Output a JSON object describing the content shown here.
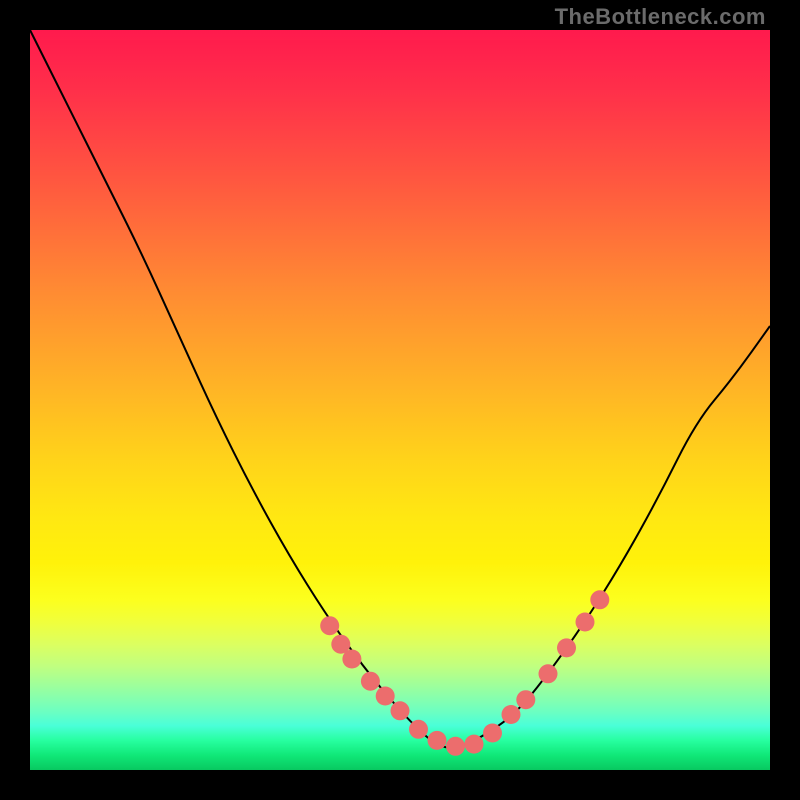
{
  "watermark": "TheBottleneck.com",
  "colors": {
    "frame": "#000000",
    "dot": "#ec6d6d",
    "curve": "#000000",
    "gradient_top": "#ff1a4d",
    "gradient_bottom": "#08c860"
  },
  "chart_data": {
    "type": "line",
    "title": "",
    "xlabel": "",
    "ylabel": "",
    "xlim": [
      0,
      100
    ],
    "ylim": [
      0,
      100
    ],
    "note": "Axes are unlabeled; x/y are percent of plot span. y is the bottleneck metric (high=red/bad, low=green/good). Curve descends steeply, bottoms near x≈56, then rises.",
    "series": [
      {
        "name": "bottleneck-curve",
        "x": [
          0,
          5,
          10,
          15,
          20,
          25,
          30,
          35,
          40,
          45,
          50,
          54,
          56,
          58,
          62,
          66,
          70,
          75,
          80,
          85,
          90,
          95,
          100
        ],
        "y": [
          100,
          90,
          80,
          70,
          59,
          48,
          38,
          29,
          21,
          14,
          8,
          4,
          3,
          3,
          5,
          8,
          13,
          20,
          28,
          37,
          47,
          53,
          60
        ]
      }
    ],
    "highlighted_points": {
      "name": "near-minimum-dots",
      "x": [
        40.5,
        42.0,
        43.5,
        46.0,
        48.0,
        50.0,
        52.5,
        55.0,
        57.5,
        60.0,
        62.5,
        65.0,
        67.0,
        70.0,
        72.5,
        75.0,
        77.0
      ],
      "y": [
        19.5,
        17.0,
        15.0,
        12.0,
        10.0,
        8.0,
        5.5,
        4.0,
        3.2,
        3.5,
        5.0,
        7.5,
        9.5,
        13.0,
        16.5,
        20.0,
        23.0
      ]
    }
  }
}
